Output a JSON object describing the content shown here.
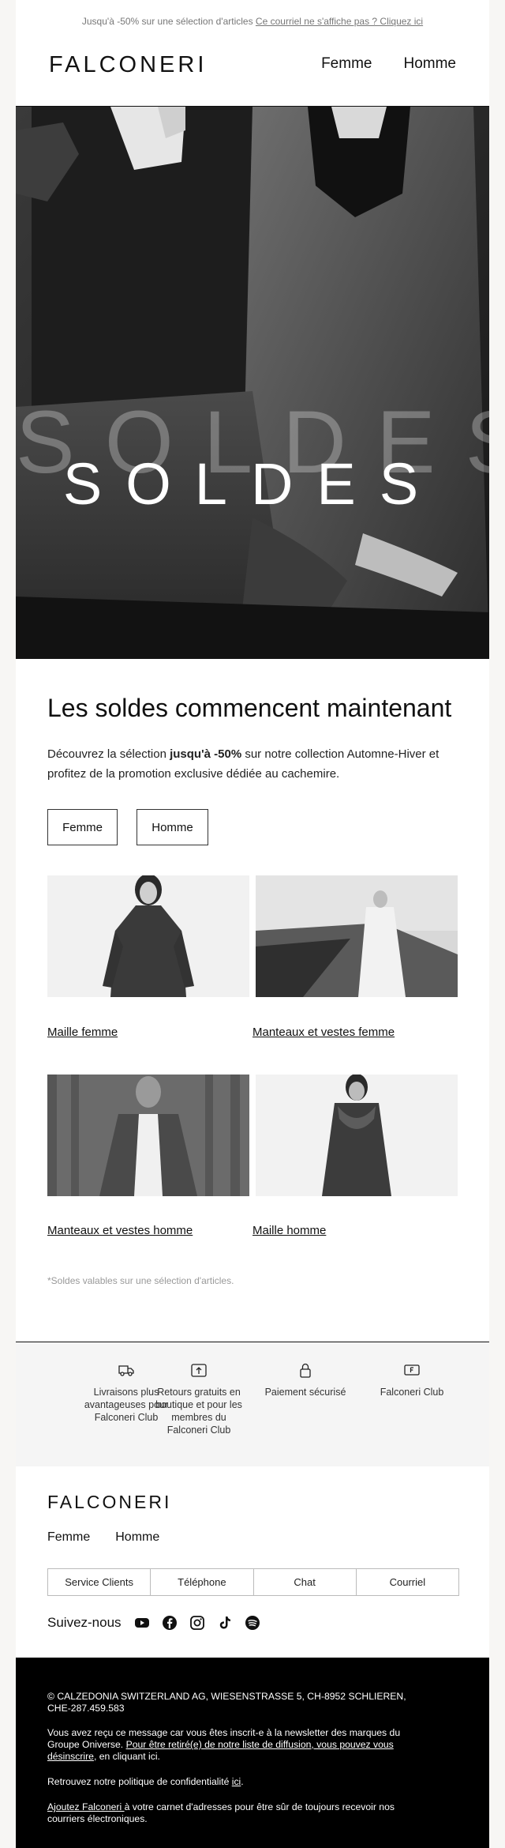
{
  "preheader": {
    "text": "Jusqu'à -50% sur une sélection d'articles",
    "link": "Ce courriel ne s'affiche pas ? Cliquez ici"
  },
  "header": {
    "brand": "FALCONERI",
    "nav": [
      "Femme",
      "Homme"
    ]
  },
  "hero": {
    "word": "SOLDES",
    "background_word": "SOLDES"
  },
  "headline": "Les soldes commencent maintenant",
  "lead": {
    "before": "Découvrez la sélection ",
    "bold": "jusqu'à -50%",
    "after": " sur notre collection Automne-Hiver et profitez de la promotion exclusive dédiée au cachemire."
  },
  "cta_buttons": [
    "Femme",
    "Homme"
  ],
  "categories": [
    {
      "label": "Maille femme"
    },
    {
      "label": "Manteaux et vestes femme"
    },
    {
      "label": "Manteaux et vestes homme"
    },
    {
      "label": "Maille homme"
    }
  ],
  "note": "*Soldes valables sur une sélection d'articles.",
  "usps": [
    {
      "icon": "delivery-truck-icon",
      "text": "Livraisons plus avantageuses pour Falconeri Club"
    },
    {
      "icon": "return-box-icon",
      "text": "Retours gratuits en boutique et pour les membres du Falconeri Club"
    },
    {
      "icon": "padlock-icon",
      "text": "Paiement sécurisé"
    },
    {
      "icon": "falconeri-card-icon",
      "text": "Falconeri Club"
    }
  ],
  "footer_top": {
    "brand": "FALCONERI",
    "nav": [
      "Femme",
      "Homme"
    ],
    "contact": [
      "Service Clients",
      "Téléphone",
      "Chat",
      "Courriel"
    ],
    "social_label": "Suivez-nous",
    "social_icons": [
      "youtube-icon",
      "facebook-icon",
      "instagram-icon",
      "tiktok-icon",
      "spotify-icon"
    ]
  },
  "legal": {
    "address": "© CALZEDONIA SWITZERLAND AG, WIESENSTRASSE 5, CH-8952 SCHLIEREN, CHE-287.459.583",
    "reason_before": "Vous avez reçu ce message car vous êtes inscrit-e à la newsletter des marques du Groupe Oniverse. ",
    "unsubscribe_link": "Pour être retiré(e) de notre liste de diffusion, vous pouvez vous désinscrire",
    "reason_after": ", en cliquant ici.",
    "privacy_before": "Retrouvez notre politique de confidentialité ",
    "privacy_link": "ici",
    "privacy_after": ".",
    "addressbook_link": "Ajoutez Falconeri ",
    "addressbook_after": "à votre carnet d'adresses pour être sûr de toujours recevoir nos courriers électroniques."
  },
  "colors": {
    "background": "#f7f6f4",
    "text": "#111111",
    "muted": "#777777",
    "usp_band": "#f5f5f5",
    "footer": "#000000"
  }
}
